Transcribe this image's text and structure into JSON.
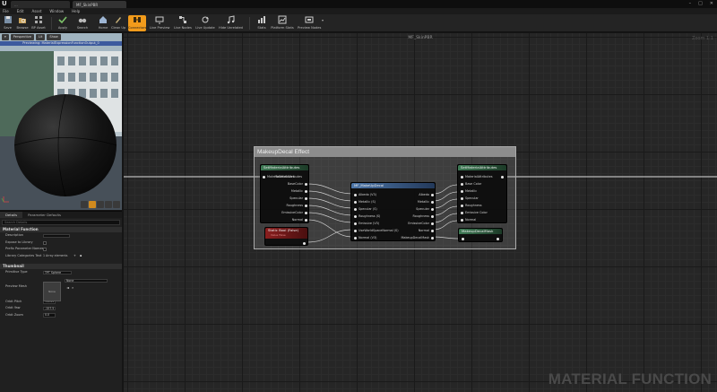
{
  "titlebar": {
    "tab_left": "...",
    "tab_active": "MF_SkinPBR"
  },
  "menu": [
    "File",
    "Edit",
    "Asset",
    "Window",
    "Help"
  ],
  "toolbar": {
    "buttons": [
      "Save",
      "Browse",
      "BP Asset",
      "Apply",
      "Search",
      "Home",
      "Clean Up",
      "Connectors",
      "Live Preview",
      "Live Nodes",
      "Live Update",
      "Hide Unrelated",
      "Stats",
      "Platform Stats",
      "Preview Nodes"
    ]
  },
  "viewport": {
    "chips": [
      "Perspective",
      "Lit",
      "Show"
    ],
    "banner": "Previewing: MaterialExpressionFunctionOutput_0"
  },
  "details": {
    "tabs": [
      "Details",
      "Parameter Defaults"
    ],
    "search_placeholder": "Search Details",
    "material_function": {
      "header": "Material Function",
      "props": [
        {
          "label": "Description",
          "value": ""
        },
        {
          "label": "Expose to Library",
          "value": ""
        },
        {
          "label": "Prefix Parameter Names",
          "value": ""
        },
        {
          "label": "Library Categories Text",
          "value": "1 Array elements"
        }
      ]
    },
    "thumbnail": {
      "header": "Thumbnail",
      "props": [
        {
          "label": "Primitive Type",
          "value": "TPT Sphere"
        },
        {
          "label": "Preview Mesh",
          "value": "None"
        },
        {
          "label": "Orbit Pitch",
          "value": "-11.25"
        },
        {
          "label": "Orbit Yaw",
          "value": "-157.5"
        },
        {
          "label": "Orbit Zoom",
          "value": "0.0"
        }
      ],
      "preview_mesh_thumb": "None"
    }
  },
  "graph": {
    "title": "MF_SkinPBR",
    "zoom": "Zoom 1:1",
    "watermark": "MATERIAL FUNCTION",
    "comment": "MakeupDecal Effect",
    "nodes": {
      "left": {
        "title": "SetMaterialAttributes",
        "pins": [
          "MaterialAttributes",
          "BaseColor",
          "Metallic",
          "Specular",
          "Roughness",
          "EmissiveColor",
          "Normal"
        ]
      },
      "static_bool": {
        "title": "Static Bool (False)",
        "subtitle": "Value False"
      },
      "center": {
        "title": "MF_MakeUpDecal",
        "inputs": [
          "Albedo (V3)",
          "Metallic (S)",
          "Specular (S)",
          "Roughness (S)",
          "Emissive (V3)",
          "UseWorldSpaceNormal (S)",
          "Normal (V3)"
        ],
        "outputs": [
          "Albedo",
          "Metallic",
          "Specular",
          "Roughness",
          "EmissiveColor",
          "Normal",
          "MakeupDecalMask"
        ]
      },
      "right": {
        "title": "SetMaterialAttributes",
        "pins": [
          "MaterialAttributes",
          "Base Color",
          "Metallic",
          "Specular",
          "Roughness",
          "Emissive Color",
          "Normal"
        ]
      },
      "mask": {
        "title": "MakeupDecalMask"
      }
    }
  }
}
